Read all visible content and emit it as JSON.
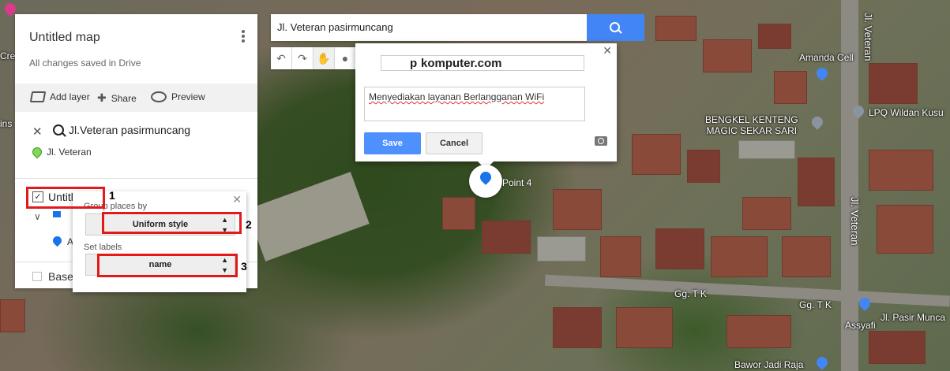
{
  "map_panel": {
    "title": "Untitled map",
    "status": "All changes saved in Drive",
    "add_layer": "Add layer",
    "share": "Share",
    "preview": "Preview",
    "search_result_title": "Jl.Veteran pasirmuncang",
    "search_result_item": "Jl. Veteran",
    "layer_name": "Untitl",
    "layer_item_letter": "A",
    "base_map": "Base"
  },
  "style_popup": {
    "group_label": "Group places by",
    "group_value": "Uniform style",
    "labels_label": "Set labels",
    "labels_value": "name"
  },
  "search": {
    "value": "Jl. Veteran pasirmuncang"
  },
  "info_window": {
    "title": "komputer.com",
    "title_prefix": "p",
    "description": "Menyediakan layanan Berlangganan WiFi",
    "save": "Save",
    "cancel": "Cancel"
  },
  "marker": {
    "label": "Point 4"
  },
  "annotations": [
    "1",
    "2",
    "3"
  ],
  "map_labels": {
    "amanda_cell": "Amanda Cell",
    "jl_veteran": "Jl. Veteran",
    "bengkel_1": "BENGKEL KENTENG",
    "bengkel_2": "MAGIC SEKAR SARI",
    "lpq": "LPQ Wildan Kusu",
    "gg_tk_1": "Gg. T K",
    "gg_tk_2": "Gg. T K",
    "jl_pasir": "Jl. Pasir Munca",
    "assyafi": "Assyafi",
    "bawor": "Bawor Jadi Raja",
    "crea": "Crea",
    "ins": "ins"
  },
  "colors": {
    "accent": "#4285f4",
    "annotation": "#e21a1a"
  }
}
